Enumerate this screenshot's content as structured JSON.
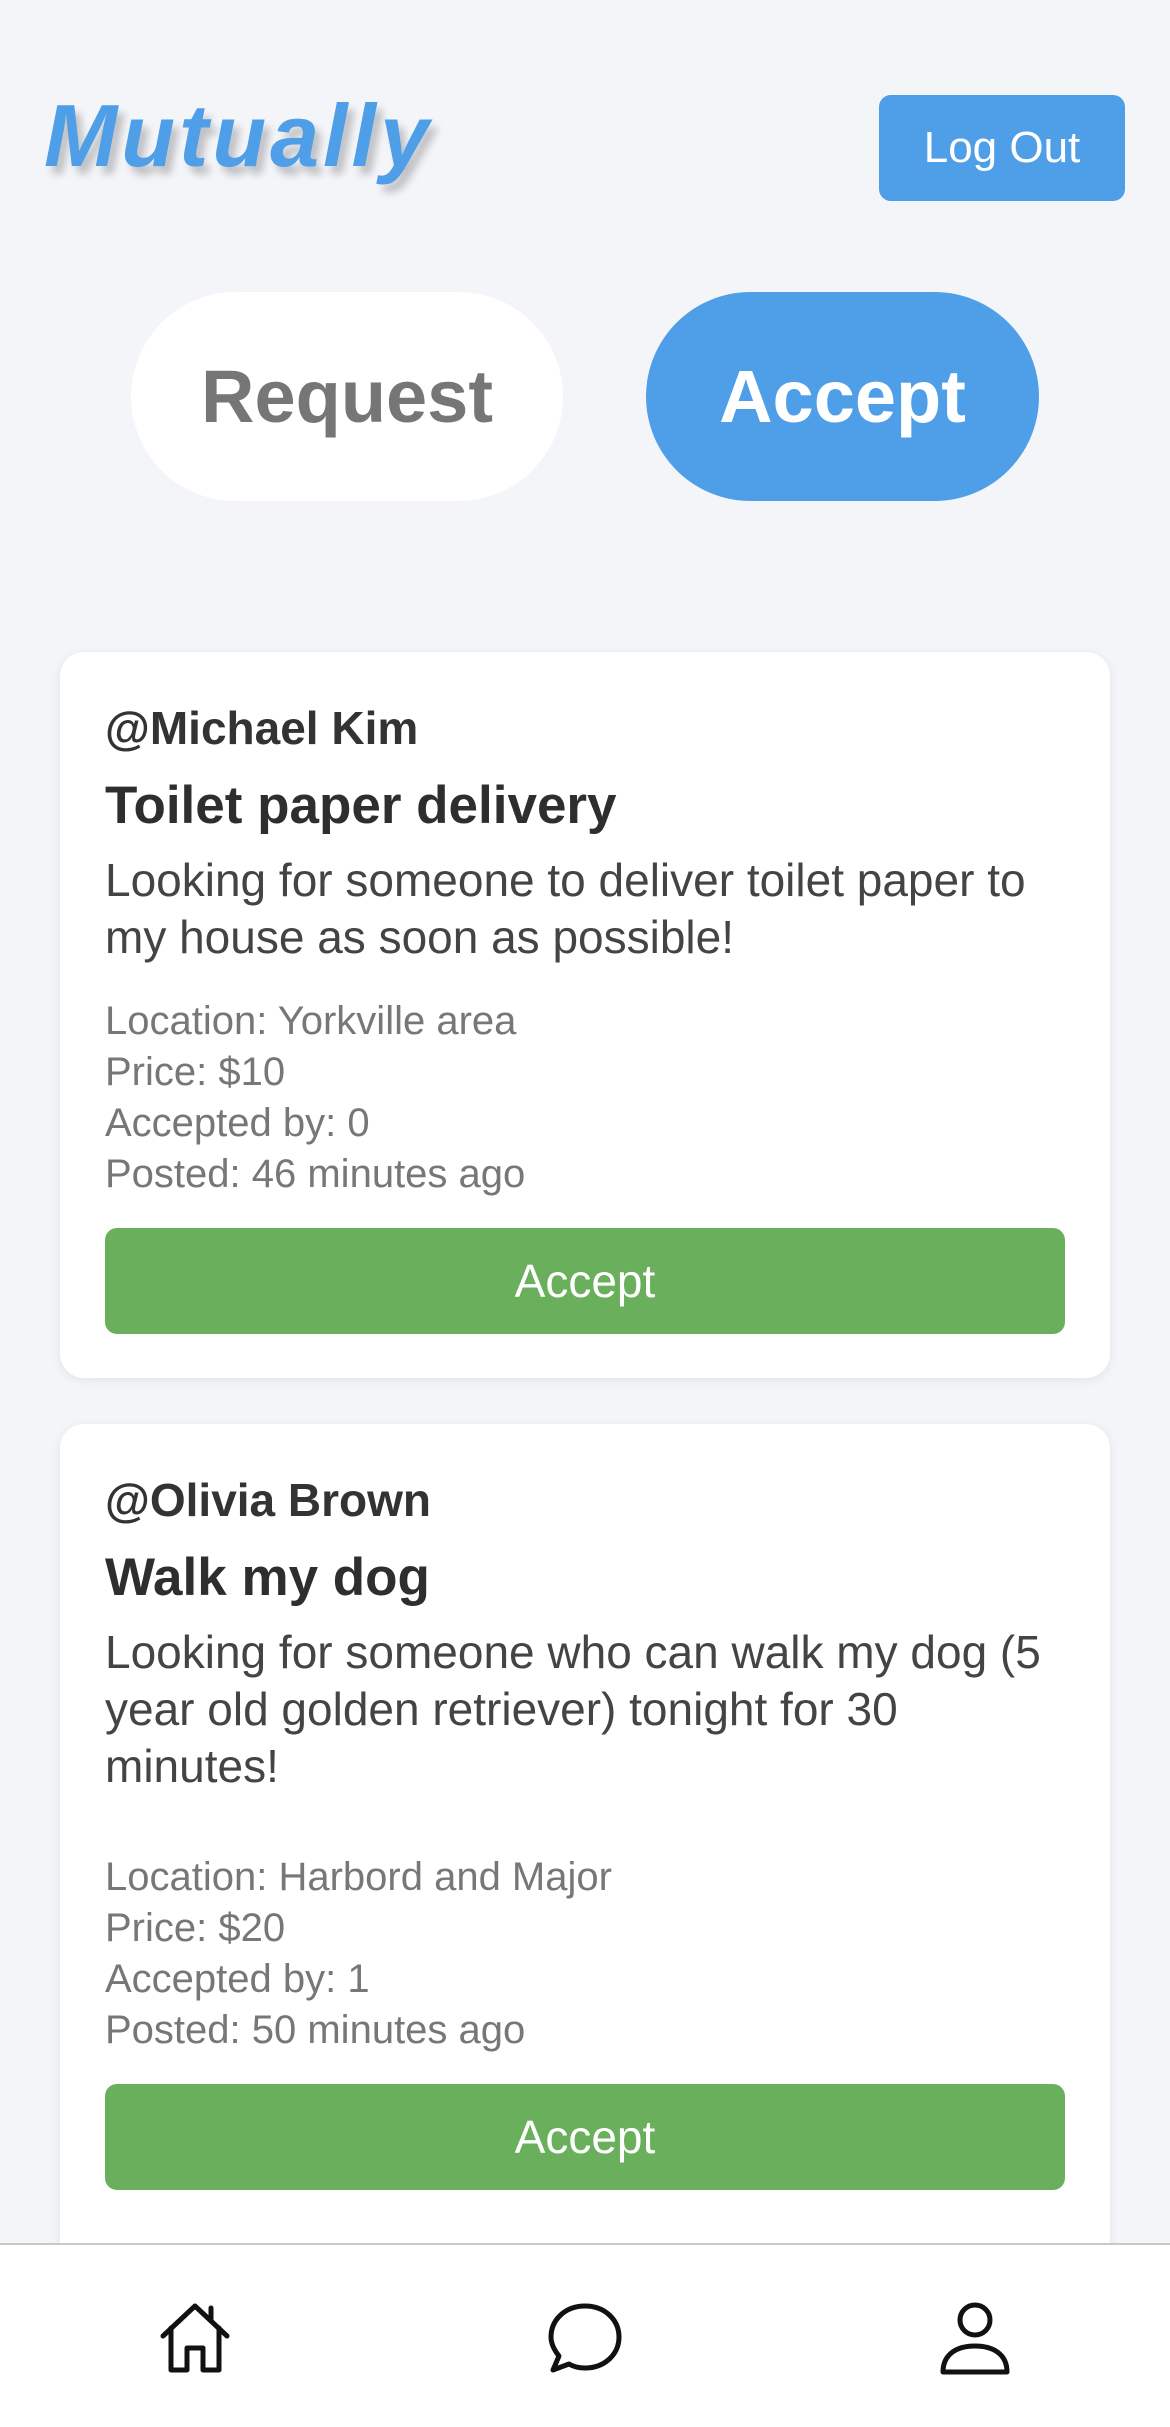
{
  "header": {
    "logo": "Mutually",
    "logout_label": "Log Out"
  },
  "mode_toggle": {
    "request_label": "Request",
    "accept_label": "Accept",
    "active": "Accept"
  },
  "posts": [
    {
      "user": "@Michael Kim",
      "title": "Toilet paper delivery",
      "description": "Looking for someone to deliver toilet paper to my house as soon as possible!",
      "location": "Location: Yorkville area",
      "price": "Price: $10",
      "accepted_by": "Accepted by: 0",
      "posted": "Posted: 46 minutes ago",
      "button_label": "Accept"
    },
    {
      "user": "@Olivia Brown",
      "title": "Walk my dog",
      "description": "Looking for someone who can walk my dog (5 year old golden retriever) tonight for 30 minutes!",
      "location": "Location: Harbord and Major",
      "price": "Price: $20",
      "accepted_by": "Accepted by: 1",
      "posted": "Posted: 50 minutes ago",
      "button_label": "Accept"
    }
  ],
  "nav": {
    "items": [
      "home-icon",
      "chat-icon",
      "profile-icon"
    ]
  },
  "colors": {
    "accent": "#4f9ee8",
    "accept_green": "#6aaf5c",
    "background": "#f3f5f9"
  }
}
